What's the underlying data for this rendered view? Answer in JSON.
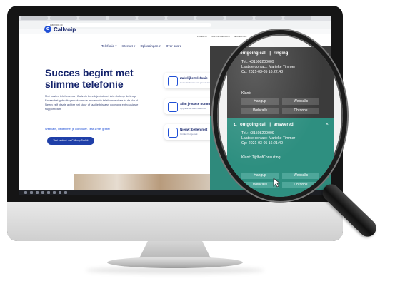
{
  "site": {
    "logo_text": "Callvoip",
    "nav": [
      "Telefonie ▾",
      "Internet ▾",
      "Oplossingen ▾",
      "Over ons ▾"
    ],
    "top_links": [
      "ZAKELIJK",
      "KLANTENSERVICE",
      "BESTELLING",
      "SUPPORT",
      "LOGIN"
    ],
    "hero_title_line1": "Succes begint met",
    "hero_title_line2": "slimme telefonie",
    "hero_body": "Met hosted telefonie van Callvoip bereik je dat met één druk op de knop. Ervaar het gebruiksgemak van de modernste telefooncentrale in de cloud. Neem zelf plaats achter het stuur of laat je bijstaan door ons enthousiaste supportteam.",
    "hero_link": "Webcalls, bellen met je computer. Test 1 mel gratis!",
    "cta_label": "Vrai aanbod: de Callvoip Toolkit",
    "url": "callvoip.nl",
    "cards": [
      {
        "title": "Zakelijke telefonie",
        "sub": "Hosted telefonie van jouw team"
      },
      {
        "title": "Slim je vaste nummer",
        "sub": "Upgrade de vaste telefonie"
      },
      {
        "title": "Nieuw: bellen met",
        "sub": "Ontdek het gemak"
      }
    ]
  },
  "notif_ringing": {
    "title": "outgoing call",
    "status": "ringing",
    "tel": "Tel.: +31508200009",
    "contact": "Laatste contact: Marieke Timmer",
    "op": "Op: 2021-03-05 16:22:43",
    "client": "Klant:",
    "buttons": [
      "Hangup",
      "Webcalls",
      "Webcalls",
      "Chronos"
    ]
  },
  "notif_answered": {
    "title": "outgoing call",
    "status": "answered",
    "tel": "Tel.: +31508200009",
    "contact": "Laatste contact: Marieke Timmer",
    "op": "Op: 2021-03-05 16:21:40",
    "client": "Klant: TijdhofConsulting",
    "buttons": [
      "Hangup",
      "Webcalls",
      "Webcalls",
      "Chronos"
    ]
  },
  "colors": {
    "brand": "#1f4fd6",
    "navy": "#14236b",
    "dark_panel": "#3b3b3b",
    "green_panel": "#2e8f80"
  }
}
